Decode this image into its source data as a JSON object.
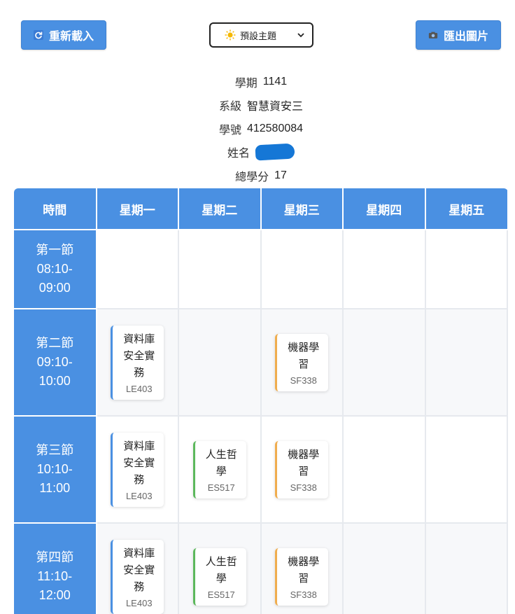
{
  "toolbar": {
    "reload_label": "重新載入",
    "export_label": "匯出圖片",
    "theme_selected": "預設主題"
  },
  "info": {
    "semester_label": "學期",
    "semester_value": "1141",
    "class_label": "系級",
    "class_value": "智慧資安三",
    "id_label": "學號",
    "id_value": "412580084",
    "name_label": "姓名",
    "credits_label": "總學分",
    "credits_value": "17"
  },
  "table": {
    "headers": [
      "時間",
      "星期一",
      "星期二",
      "星期三",
      "星期四",
      "星期五"
    ],
    "periods": [
      {
        "name": "第一節",
        "start": "08:10-",
        "end": "09:00"
      },
      {
        "name": "第二節",
        "start": "09:10-",
        "end": "10:00"
      },
      {
        "name": "第三節",
        "start": "10:10-",
        "end": "11:00"
      },
      {
        "name": "第四節",
        "start": "11:10-",
        "end": "12:00"
      }
    ],
    "courses": {
      "db": {
        "line1": "資料庫",
        "line2": "安全實",
        "line3": "務",
        "room": "LE403"
      },
      "ml": {
        "line1": "機器學",
        "line2": "習",
        "room": "SF338"
      },
      "ph": {
        "line1": "人生哲",
        "line2": "學",
        "room": "ES517"
      }
    }
  },
  "colors": {
    "primary": "#4a90e2",
    "course_blue": "#4a90e2",
    "course_green": "#5cb85c",
    "course_orange": "#f0ad4e",
    "redaction": "#1577d6"
  }
}
